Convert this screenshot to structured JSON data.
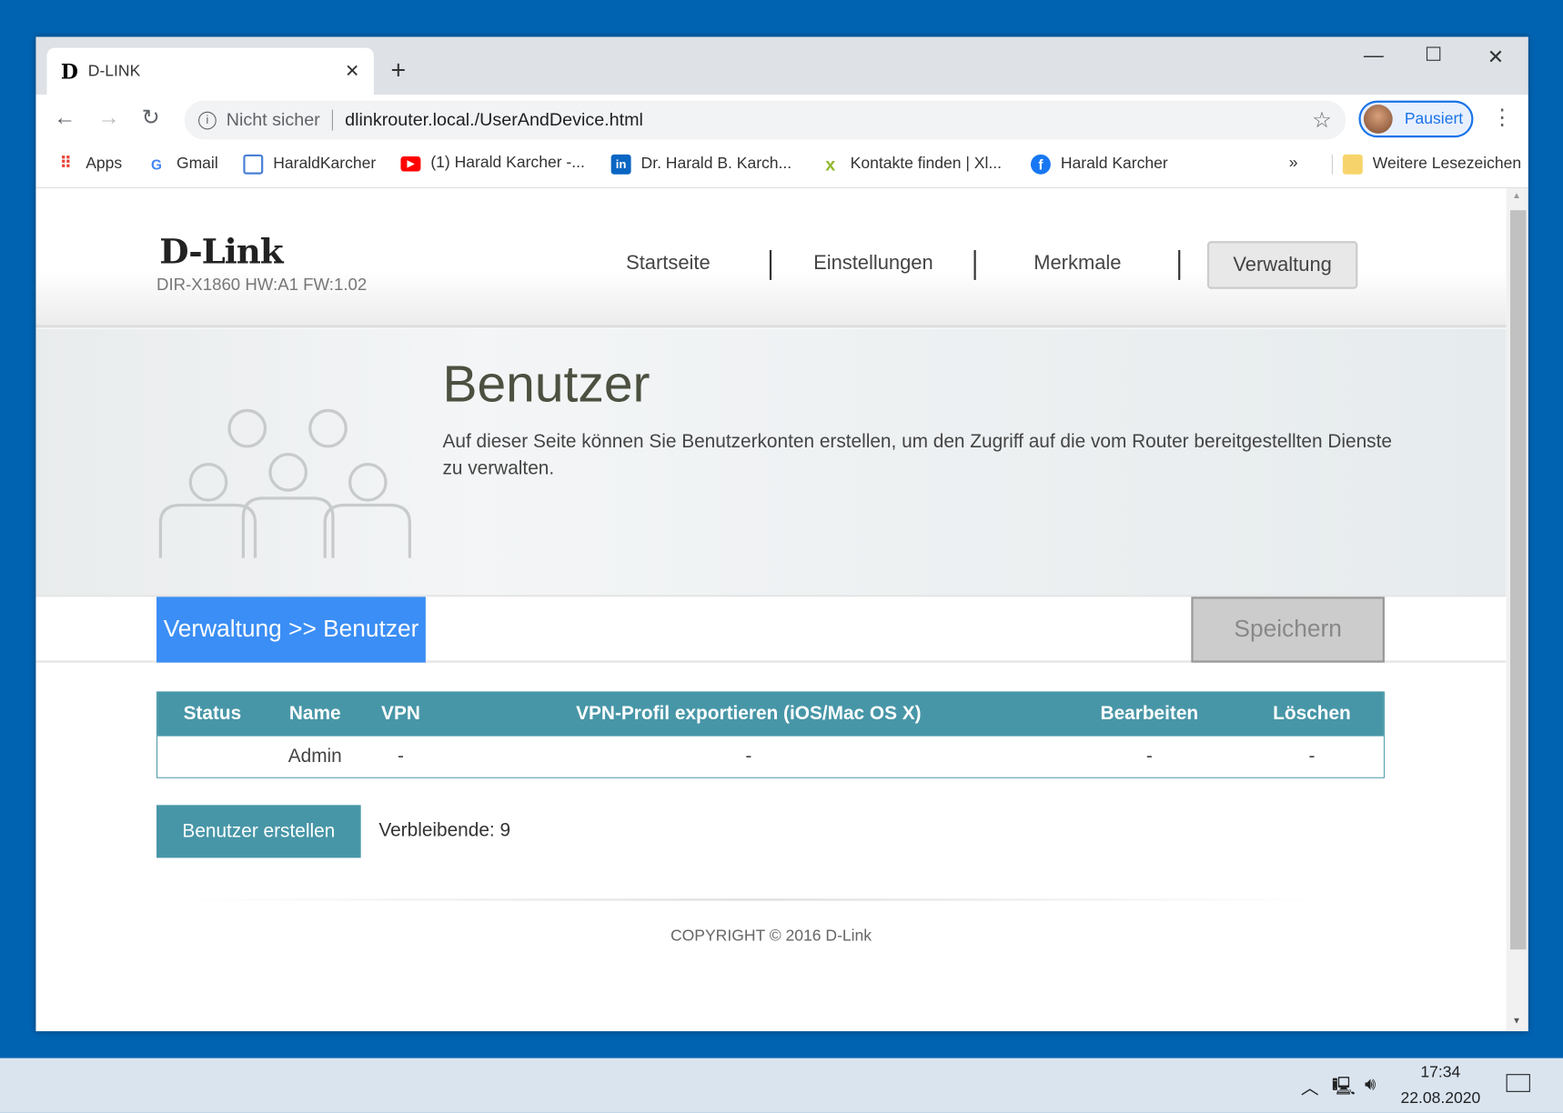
{
  "browser": {
    "tab_title": "D-LINK",
    "tab_favicon": "D",
    "new_tab": "+",
    "close_tab": "✕",
    "url_security": "Nicht sicher",
    "url": "dlinkrouter.local./UserAndDevice.html",
    "profile_label": "Pausiert",
    "bookmarks": [
      {
        "label": "Apps",
        "icon": "apps-grid-icon"
      },
      {
        "label": "Gmail",
        "icon": "google-icon"
      },
      {
        "label": "HaraldKarcher",
        "icon": "site-icon"
      },
      {
        "label": "(1) Harald Karcher -...",
        "icon": "youtube-icon"
      },
      {
        "label": "Dr. Harald B. Karch...",
        "icon": "linkedin-icon"
      },
      {
        "label": "Kontakte finden | Xl...",
        "icon": "xing-icon"
      },
      {
        "label": "Harald Karcher",
        "icon": "facebook-icon"
      }
    ],
    "overflow": "»",
    "other_bookmarks": "Weitere Lesezeichen"
  },
  "router": {
    "logo": "D-Link",
    "model": "DIR-X1860 HW:A1 FW:1.02",
    "nav": [
      "Startseite",
      "Einstellungen",
      "Merkmale",
      "Verwaltung"
    ],
    "title": "Benutzer",
    "description": "Auf dieser Seite können Sie Benutzerkonten erstellen, um den Zugriff auf die vom Router bereitgestellten Dienste zu verwalten.",
    "breadcrumb": "Verwaltung >> Benutzer",
    "save": "Speichern",
    "table": {
      "headers": [
        "Status",
        "Name",
        "VPN",
        "VPN-Profil exportieren (iOS/Mac OS X)",
        "Bearbeiten",
        "Löschen"
      ],
      "rows": [
        [
          "",
          "Admin",
          "-",
          "-",
          "-",
          "-"
        ]
      ]
    },
    "create_button": "Benutzer erstellen",
    "remaining": "Verbleibende: 9",
    "copyright": "COPYRIGHT © 2016 D-Link"
  },
  "taskbar": {
    "time": "17:34",
    "date": "22.08.2020"
  },
  "colors": {
    "accent": "#4796a7",
    "crumb": "#3b8ef5",
    "desktop": "#0063b1"
  }
}
